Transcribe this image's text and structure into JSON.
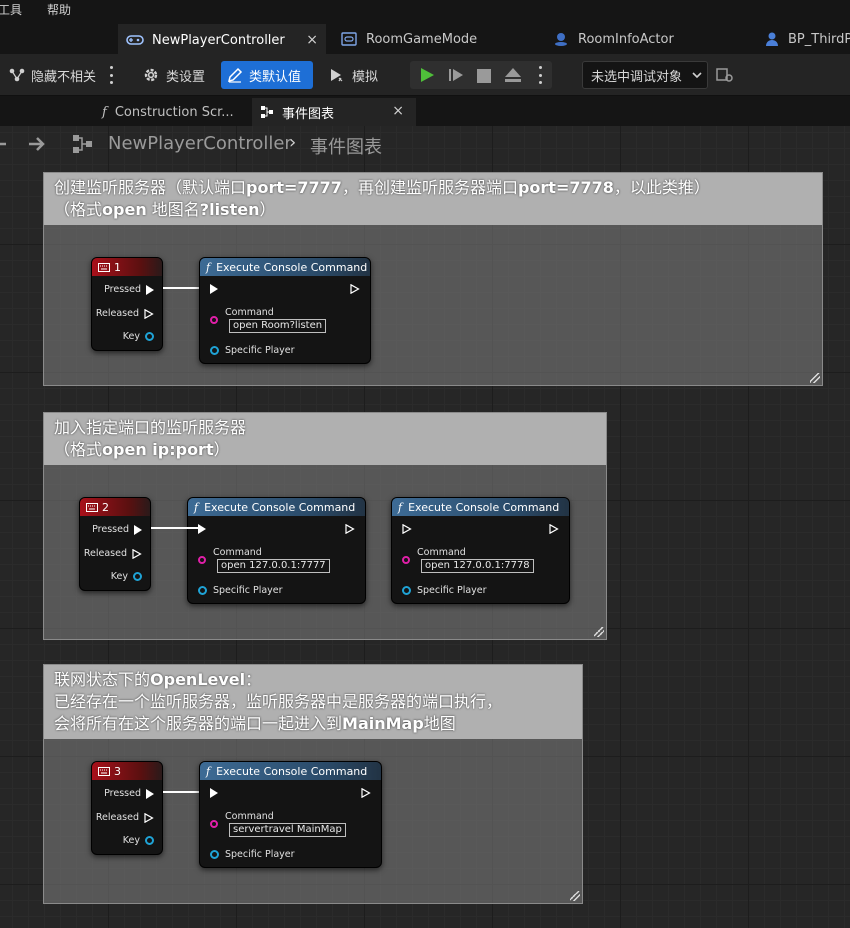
{
  "menu": {
    "tools": "工具",
    "help": "帮助"
  },
  "tabs": [
    {
      "label": "NewPlayerController",
      "close": "×"
    },
    {
      "label": "RoomGameMode"
    },
    {
      "label": "RoomInfoActor"
    },
    {
      "label": "BP_ThirdPe"
    }
  ],
  "toolbar": {
    "hide_unrelated": "隐藏不相关",
    "class_settings": "类设置",
    "class_defaults": "类默认值",
    "simulate": "模拟",
    "debug_target": "未选中调试对象"
  },
  "subtabs": [
    {
      "label": "Construction Scr..."
    },
    {
      "label": "事件图表",
      "close": "×"
    }
  ],
  "breadcrumb": {
    "root": "NewPlayerController",
    "sep": "›",
    "current": "事件图表"
  },
  "comments": [
    {
      "line1_pre": "创建监听服务器（默认端口",
      "line1_b1": "port=7777",
      "line1_mid": "，再创建监听服务器端口",
      "line1_b2": "port=7778",
      "line1_post": "，以此类推）",
      "line2_pre": "（格式",
      "line2_b": "open",
      "line2_mid": " 地图名",
      "line2_b2": "?listen",
      "line2_post": "）"
    },
    {
      "line1": "加入指定端口的监听服务器",
      "line2_pre": "（格式",
      "line2_b": "open ip:port",
      "line2_post": "）"
    },
    {
      "line1_pre": "联网状态下的",
      "line1_b": "OpenLevel",
      "line1_post": "：",
      "line2": "已经存在一个监听服务器，监听服务器中是服务器的端口执行，",
      "line3_pre": "会将所有在这个服务器的端口一起进入到",
      "line3_b": "MainMap",
      "line3_post": "地图"
    }
  ],
  "key_nodes": [
    {
      "title": "1",
      "pressed": "Pressed",
      "released": "Released",
      "key": "Key"
    },
    {
      "title": "2",
      "pressed": "Pressed",
      "released": "Released",
      "key": "Key"
    },
    {
      "title": "3",
      "pressed": "Pressed",
      "released": "Released",
      "key": "Key"
    }
  ],
  "exec_nodes": [
    {
      "title": "Execute Console Command",
      "command_label": "Command",
      "command": "open Room?listen",
      "player": "Specific Player"
    },
    {
      "title": "Execute Console Command",
      "command_label": "Command",
      "command": "open 127.0.0.1:7777",
      "player": "Specific Player"
    },
    {
      "title": "Execute Console Command",
      "command_label": "Command",
      "command": "open 127.0.0.1:7778",
      "player": "Specific Player"
    },
    {
      "title": "Execute Console Command",
      "command_label": "Command",
      "command": "servertravel MainMap",
      "player": "Specific Player"
    }
  ]
}
